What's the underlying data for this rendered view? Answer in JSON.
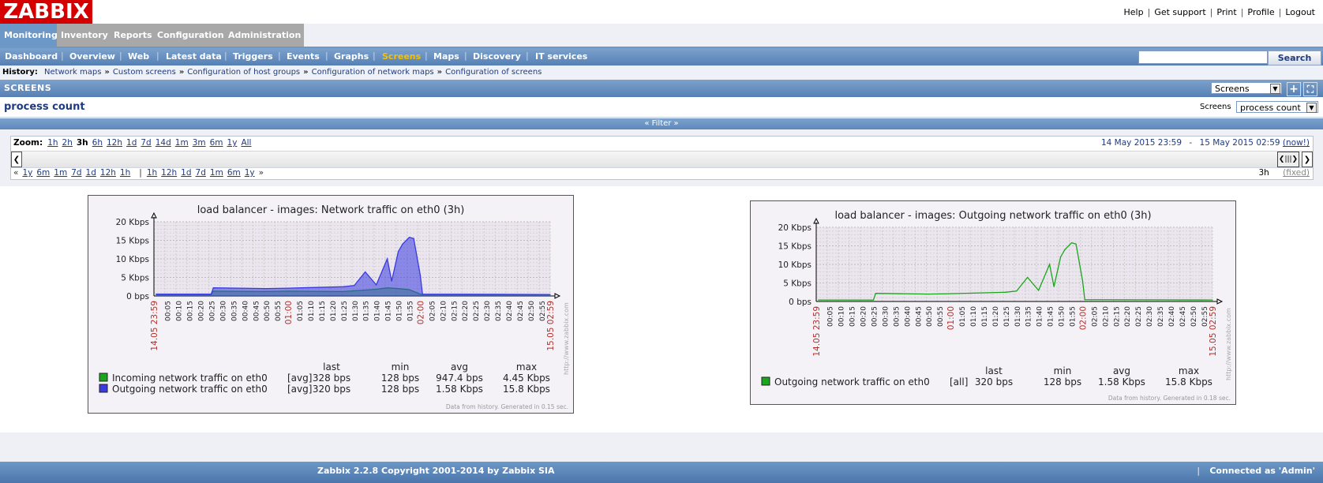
{
  "logo": "ZABBIX",
  "toplinks": [
    "Help",
    "Get support",
    "Print",
    "Profile",
    "Logout"
  ],
  "tabs": [
    {
      "label": "Monitoring",
      "active": true
    },
    {
      "label": "Inventory"
    },
    {
      "label": "Reports"
    },
    {
      "label": "Configuration"
    },
    {
      "label": "Administration"
    }
  ],
  "subnav": [
    {
      "label": "Dashboard"
    },
    {
      "label": "Overview"
    },
    {
      "label": "Web"
    },
    {
      "label": "Latest data"
    },
    {
      "label": "Triggers"
    },
    {
      "label": "Events"
    },
    {
      "label": "Graphs"
    },
    {
      "label": "Screens",
      "active": true
    },
    {
      "label": "Maps"
    },
    {
      "label": "Discovery"
    },
    {
      "label": "IT services"
    }
  ],
  "search": {
    "button": "Search"
  },
  "history": {
    "label": "History:",
    "items": [
      "Network maps",
      "Custom screens",
      "Configuration of host groups",
      "Configuration of network maps",
      "Configuration of screens"
    ]
  },
  "screens_bar": {
    "title": "SCREENS",
    "select_value": "Screens"
  },
  "page": {
    "title": "process count",
    "screens_label": "Screens",
    "screens_value": "process count"
  },
  "filter": {
    "label": "« Filter »"
  },
  "timeline": {
    "zoom_label": "Zoom:",
    "zoom": [
      "1h",
      "2h",
      "3h",
      "6h",
      "12h",
      "1d",
      "7d",
      "14d",
      "1m",
      "3m",
      "6m",
      "1y",
      "All"
    ],
    "zoom_current": "3h",
    "from": "14 May 2015 23:59",
    "dash": "-",
    "to": "15 May 2015 02:59",
    "now": "(now!)",
    "nav_back": [
      "«",
      "1y",
      "6m",
      "1m",
      "7d",
      "1d",
      "12h",
      "1h"
    ],
    "nav_sep": "|",
    "nav_fwd": [
      "1h",
      "12h",
      "1d",
      "7d",
      "1m",
      "6m",
      "1y",
      "»"
    ],
    "period": "3h",
    "fixed": "(fixed)"
  },
  "graphs": [
    {
      "title": "load balancer - images: Network traffic on eth0 (3h)",
      "y_ticks": [
        "20 Kbps",
        "15 Kbps",
        "10 Kbps",
        "5 Kbps",
        "0 bps"
      ],
      "x_start": "14.05 23:59",
      "x_end": "15.05 02:59",
      "x_ticks": [
        "00:05",
        "00:10",
        "00:15",
        "00:20",
        "00:25",
        "00:30",
        "00:35",
        "00:40",
        "00:45",
        "00:50",
        "00:55",
        "01:00",
        "01:05",
        "01:10",
        "01:15",
        "01:20",
        "01:25",
        "01:30",
        "01:35",
        "01:40",
        "01:45",
        "01:50",
        "01:55",
        "02:00",
        "02:05",
        "02:10",
        "02:15",
        "02:20",
        "02:25",
        "02:30",
        "02:35",
        "02:40",
        "02:45",
        "02:50",
        "02:55"
      ],
      "legend_headers": [
        "last",
        "min",
        "avg",
        "max"
      ],
      "legend": [
        {
          "name": "Incoming network traffic on eth0",
          "func": "[avg]",
          "last": "328 bps",
          "min": "128 bps",
          "avg": "947.4 bps",
          "max": "4.45 Kbps",
          "color": "#1aa51a"
        },
        {
          "name": "Outgoing network traffic on eth0",
          "func": "[avg]",
          "last": "320 bps",
          "min": "128 bps",
          "avg": "1.58 Kbps",
          "max": "15.8 Kbps",
          "color": "#3a3ae0"
        }
      ],
      "footer": "Data from history. Generated in 0.15 sec.",
      "watermark": "http://www.zabbix.com"
    },
    {
      "title": "load balancer - images: Outgoing network traffic on eth0 (3h)",
      "y_ticks": [
        "20 Kbps",
        "15 Kbps",
        "10 Kbps",
        "5 Kbps",
        "0 bps"
      ],
      "x_start": "14.05 23:59",
      "x_end": "15.05 02:59",
      "x_ticks": [
        "00:05",
        "00:10",
        "00:15",
        "00:20",
        "00:25",
        "00:30",
        "00:35",
        "00:40",
        "00:45",
        "00:50",
        "00:55",
        "01:00",
        "01:05",
        "01:10",
        "01:15",
        "01:20",
        "01:25",
        "01:30",
        "01:35",
        "01:40",
        "01:45",
        "01:50",
        "01:55",
        "02:00",
        "02:05",
        "02:10",
        "02:15",
        "02:20",
        "02:25",
        "02:30",
        "02:35",
        "02:40",
        "02:45",
        "02:50",
        "02:55"
      ],
      "legend_headers": [
        "last",
        "min",
        "avg",
        "max"
      ],
      "legend": [
        {
          "name": "Outgoing network traffic on eth0",
          "func": "[all]",
          "last": "320 bps",
          "min": "128 bps",
          "avg": "1.58 Kbps",
          "max": "15.8 Kbps",
          "color": "#1aa51a"
        }
      ],
      "footer": "Data from history. Generated in 0.18 sec.",
      "watermark": "http://www.zabbix.com"
    }
  ],
  "chart_data": [
    {
      "type": "area",
      "ylim": [
        0,
        20
      ],
      "unit": "Kbps",
      "series": [
        {
          "name": "Incoming network traffic on eth0",
          "color": "#1aa51a",
          "x": [
            "00:00",
            "00:25",
            "00:26",
            "00:50",
            "01:00",
            "01:25",
            "01:30",
            "01:35",
            "01:40",
            "01:45",
            "01:50",
            "01:55",
            "02:00",
            "02:01",
            "02:59"
          ],
          "values": [
            0.4,
            0.4,
            1.3,
            1.2,
            1.3,
            1.2,
            1.4,
            1.6,
            1.8,
            2.2,
            2.0,
            1.7,
            0.5,
            0.4,
            0.4
          ]
        },
        {
          "name": "Outgoing network traffic on eth0",
          "color": "#3a3ae0",
          "x": [
            "00:00",
            "00:25",
            "00:26",
            "00:50",
            "01:00",
            "01:25",
            "01:30",
            "01:35",
            "01:40",
            "01:45",
            "01:47",
            "01:50",
            "01:52",
            "01:55",
            "01:57",
            "02:00",
            "02:01",
            "02:59"
          ],
          "values": [
            0.5,
            0.5,
            2.2,
            2.0,
            2.1,
            2.5,
            2.8,
            6.5,
            3.0,
            10.0,
            4.0,
            12.0,
            14.0,
            15.8,
            15.5,
            5.5,
            0.5,
            0.4
          ]
        }
      ]
    },
    {
      "type": "line",
      "ylim": [
        0,
        20
      ],
      "unit": "Kbps",
      "series": [
        {
          "name": "Outgoing network traffic on eth0",
          "color": "#1aa51a",
          "x": [
            "00:00",
            "00:25",
            "00:26",
            "00:50",
            "01:00",
            "01:25",
            "01:30",
            "01:35",
            "01:40",
            "01:45",
            "01:47",
            "01:50",
            "01:52",
            "01:55",
            "01:57",
            "02:00",
            "02:01",
            "02:59"
          ],
          "values": [
            0.4,
            0.4,
            2.2,
            2.0,
            2.1,
            2.5,
            2.8,
            6.5,
            3.0,
            10.0,
            4.0,
            12.0,
            14.0,
            15.8,
            15.5,
            5.5,
            0.5,
            0.4
          ]
        }
      ]
    }
  ]
}
